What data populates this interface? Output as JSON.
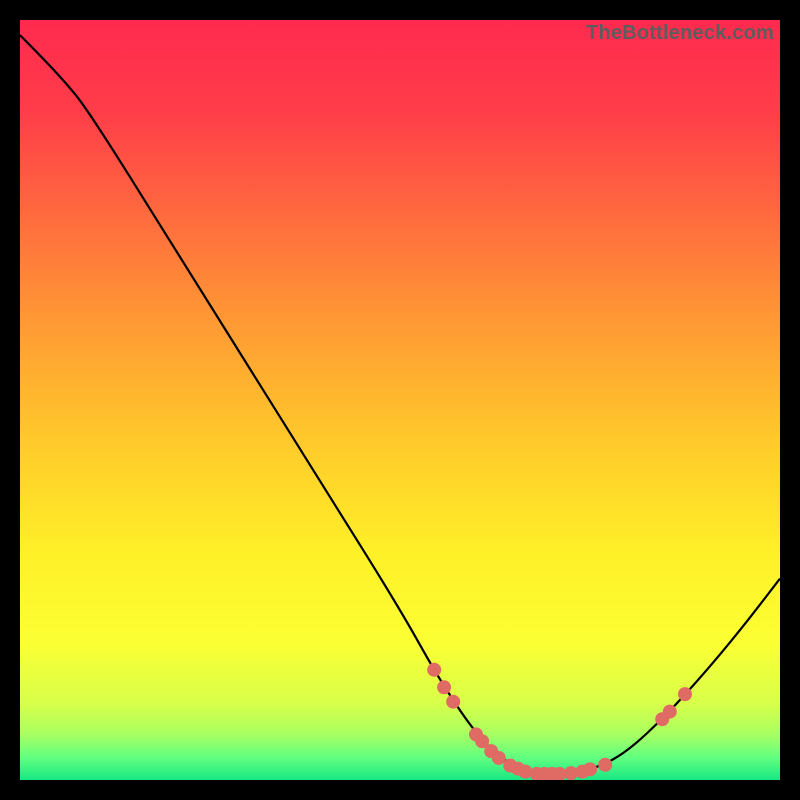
{
  "attribution": "TheBottleneck.com",
  "chart_data": {
    "type": "line",
    "xlabel": "",
    "ylabel": "",
    "xlim": [
      0,
      100
    ],
    "ylim": [
      0,
      100
    ],
    "grid": false,
    "curve": [
      {
        "x": 0.0,
        "y": 98.0
      },
      {
        "x": 6.0,
        "y": 92.0
      },
      {
        "x": 10.0,
        "y": 86.5
      },
      {
        "x": 20.0,
        "y": 70.5
      },
      {
        "x": 30.0,
        "y": 54.5
      },
      {
        "x": 40.0,
        "y": 38.5
      },
      {
        "x": 50.0,
        "y": 22.5
      },
      {
        "x": 55.0,
        "y": 13.5
      },
      {
        "x": 60.0,
        "y": 6.0
      },
      {
        "x": 64.0,
        "y": 2.2
      },
      {
        "x": 68.0,
        "y": 0.8
      },
      {
        "x": 72.0,
        "y": 0.8
      },
      {
        "x": 76.0,
        "y": 1.6
      },
      {
        "x": 80.0,
        "y": 3.8
      },
      {
        "x": 85.0,
        "y": 8.5
      },
      {
        "x": 90.0,
        "y": 14.0
      },
      {
        "x": 95.0,
        "y": 20.0
      },
      {
        "x": 100.0,
        "y": 26.5
      }
    ],
    "markers": [
      {
        "x": 54.5,
        "y": 14.5
      },
      {
        "x": 55.8,
        "y": 12.2
      },
      {
        "x": 57.0,
        "y": 10.3
      },
      {
        "x": 60.0,
        "y": 6.0
      },
      {
        "x": 60.8,
        "y": 5.1
      },
      {
        "x": 62.0,
        "y": 3.8
      },
      {
        "x": 63.0,
        "y": 2.9
      },
      {
        "x": 64.5,
        "y": 1.9
      },
      {
        "x": 65.5,
        "y": 1.5
      },
      {
        "x": 66.5,
        "y": 1.1
      },
      {
        "x": 68.0,
        "y": 0.8
      },
      {
        "x": 69.0,
        "y": 0.8
      },
      {
        "x": 70.0,
        "y": 0.8
      },
      {
        "x": 71.0,
        "y": 0.8
      },
      {
        "x": 72.5,
        "y": 0.9
      },
      {
        "x": 74.0,
        "y": 1.1
      },
      {
        "x": 75.0,
        "y": 1.4
      },
      {
        "x": 77.0,
        "y": 2.0
      },
      {
        "x": 84.5,
        "y": 8.0
      },
      {
        "x": 85.5,
        "y": 9.0
      },
      {
        "x": 87.5,
        "y": 11.3
      }
    ],
    "background_gradient": {
      "stops": [
        {
          "offset": 0.0,
          "color": "#ff2a4f"
        },
        {
          "offset": 0.12,
          "color": "#ff3d49"
        },
        {
          "offset": 0.26,
          "color": "#ff6b3e"
        },
        {
          "offset": 0.4,
          "color": "#ff9a34"
        },
        {
          "offset": 0.55,
          "color": "#ffc82b"
        },
        {
          "offset": 0.7,
          "color": "#fff028"
        },
        {
          "offset": 0.82,
          "color": "#fbff33"
        },
        {
          "offset": 0.9,
          "color": "#d7ff4a"
        },
        {
          "offset": 0.94,
          "color": "#a8ff62"
        },
        {
          "offset": 0.97,
          "color": "#63ff80"
        },
        {
          "offset": 1.0,
          "color": "#18e884"
        }
      ]
    },
    "curve_color": "#000000",
    "marker_color": "#e06a64",
    "marker_radius": 7
  }
}
